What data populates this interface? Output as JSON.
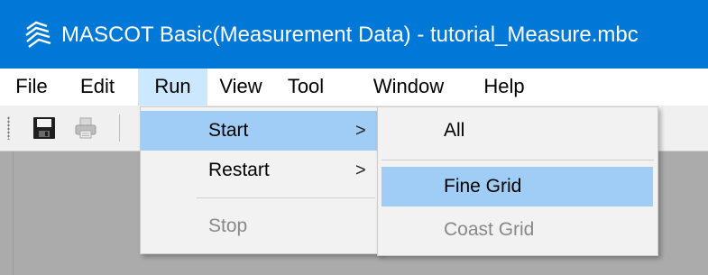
{
  "window": {
    "title": "MASCOT Basic(Measurement Data) - tutorial_Measure.mbc",
    "app_icon": "mascot-logo-icon"
  },
  "menubar": {
    "items": [
      {
        "label": "File"
      },
      {
        "label": "Edit"
      },
      {
        "label": "Run",
        "active": true
      },
      {
        "label": "View"
      },
      {
        "label": "Tool"
      },
      {
        "label": "Window"
      },
      {
        "label": "Help"
      }
    ]
  },
  "toolbar": {
    "buttons": [
      {
        "icon": "save-icon"
      },
      {
        "icon": "print-icon",
        "disabled": true
      }
    ]
  },
  "run_menu": {
    "items": [
      {
        "label": "Start",
        "submenu_arrow": ">",
        "highlighted": true
      },
      {
        "label": "Restart",
        "submenu_arrow": ">"
      },
      {
        "label": "Stop",
        "disabled": true
      }
    ]
  },
  "start_submenu": {
    "items": [
      {
        "label": "All"
      },
      {
        "label": "Fine Grid",
        "highlighted": true
      },
      {
        "label": "Coast Grid",
        "disabled": true
      }
    ]
  },
  "colors": {
    "titlebar": "#0078d7",
    "menu_active": "#cce8ff",
    "menu_highlight": "#9fcdf5",
    "workspace": "#ababab"
  }
}
